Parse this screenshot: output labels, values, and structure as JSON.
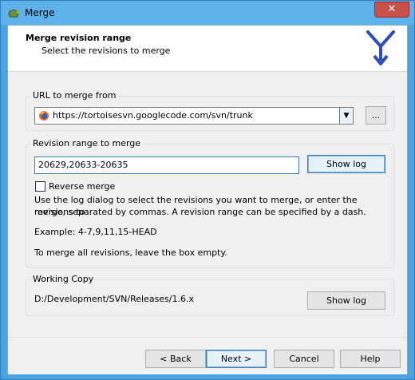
{
  "window": {
    "title": "Merge",
    "close_glyph": "✕"
  },
  "header": {
    "title": "Merge revision range",
    "subtitle": "Select the revisions to merge"
  },
  "url_group": {
    "label": "URL to merge from",
    "url_value": "https://tortoisesvn.googlecode.com/svn/trunk",
    "dropdown_glyph": "▼",
    "browse_label": "..."
  },
  "revision_group": {
    "label": "Revision range to merge",
    "range_value": "20629,20633-20635",
    "show_log_label": "Show log",
    "reverse_merge_label": "Reverse merge",
    "reverse_merge_checked": false,
    "help_line1": "Use the log dialog to select the revisions you want to merge, or enter the revisions to",
    "help_line2": "merge, separated by commas. A revision range can be specified by a dash.",
    "example": "Example: 4-7,9,11,15-HEAD",
    "empty_hint": "To merge all revisions, leave the box empty."
  },
  "working_copy_group": {
    "label": "Working Copy",
    "path": "D:/Development/SVN/Releases/1.6.x",
    "show_log_label": "Show log"
  },
  "footer": {
    "back_label": "< Back",
    "next_label": "Next >",
    "cancel_label": "Cancel",
    "help_label": "Help"
  },
  "colors": {
    "title_bar": "#5db2ea",
    "close_button": "#c7504a",
    "logo_blue": "#2b4fb5",
    "focus_border": "#3c7fb1"
  },
  "icons": {
    "app": "tortoise-icon",
    "logo": "tortoisesvn-merge-logo-icon",
    "url_field": "firefox-icon"
  }
}
